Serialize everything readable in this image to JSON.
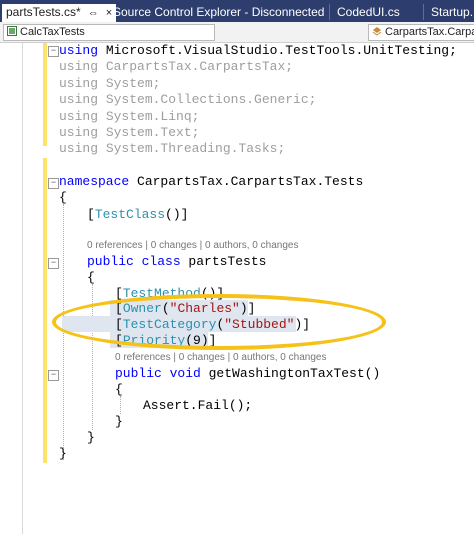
{
  "tabs": [
    {
      "label": "partsTests.cs*",
      "active": true,
      "pin": "⇔",
      "close": "×"
    },
    {
      "label": "Source Control Explorer - Disconnected",
      "active": false
    },
    {
      "label": "CodedUI.cs",
      "active": false
    },
    {
      "label": "Startup.",
      "active": false
    }
  ],
  "navbar": {
    "left": "CalcTaxTests",
    "right": "CarpartsTax.Carpar"
  },
  "code": {
    "l1": {
      "kw": "using",
      "rest": " Microsoft.VisualStudio.TestTools.UnitTesting;"
    },
    "l2": {
      "kw": "using",
      "rest": " CarpartsTax.CarpartsTax;"
    },
    "l3": {
      "kw": "using",
      "rest": " System;"
    },
    "l4": {
      "kw": "using",
      "rest": " System.Collections.Generic;"
    },
    "l5": {
      "kw": "using",
      "rest": " System.Linq;"
    },
    "l6": {
      "kw": "using",
      "rest": " System.Text;"
    },
    "l7": {
      "kw": "using",
      "rest": " System.Threading.Tasks;"
    },
    "l8": {
      "kw": "namespace",
      "rest": " CarpartsTax.CarpartsTax.Tests"
    },
    "l9": "{",
    "l10": {
      "open": "[",
      "type": "TestClass",
      "close": "()]"
    },
    "lens1": "0 references | 0 changes | 0 authors, 0 changes",
    "l11": {
      "kw1": "public",
      "kw2": " class",
      "rest": " partsTests"
    },
    "l12": "{",
    "l13": {
      "open": "[",
      "type": "TestMethod",
      "close": "()]"
    },
    "l14": {
      "open": "[",
      "type": "Owner",
      "mid": "(",
      "str": "\"Charles\"",
      "close": ")]"
    },
    "l15": {
      "open": "[",
      "type": "TestCategory",
      "mid": "(",
      "str": "\"Stubbed\"",
      "close": ")]"
    },
    "l16": {
      "open": "[",
      "type": "Priority",
      "close": "(9)]"
    },
    "lens2": "0 references | 0 changes | 0 authors, 0 changes",
    "l17": {
      "kw1": "public",
      "kw2": " void",
      "rest": " getWashingtonTaxTest()"
    },
    "l18": "{",
    "l19": "Assert.Fail();",
    "l20": "}",
    "l21": "}",
    "l22": "}"
  },
  "fold_glyph": "−",
  "colors": {
    "tab_strip": "#2d3e6e",
    "change_bar": "#fde36b",
    "annotation": "#f6c21a"
  }
}
